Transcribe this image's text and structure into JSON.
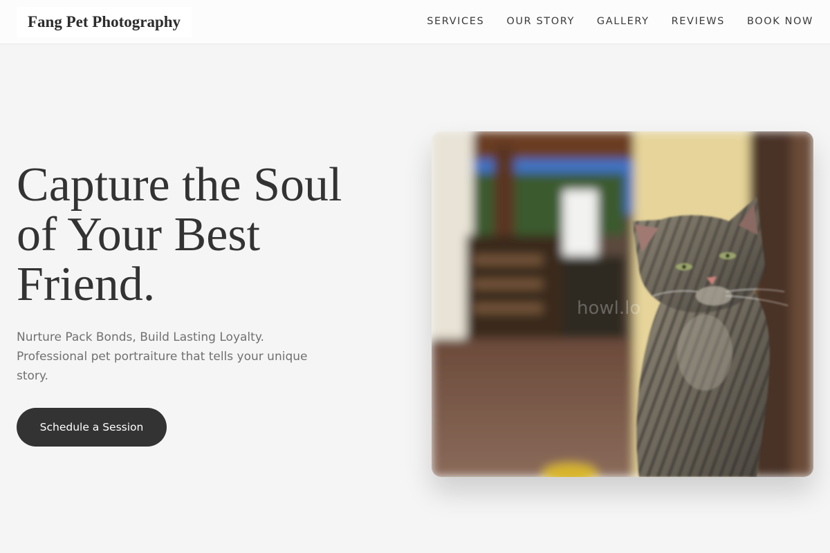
{
  "brand": {
    "name": "Fang Pet Photography"
  },
  "nav": {
    "items": [
      {
        "label": "SERVICES"
      },
      {
        "label": "OUR STORY"
      },
      {
        "label": "GALLERY"
      },
      {
        "label": "REVIEWS"
      },
      {
        "label": "BOOK NOW"
      }
    ]
  },
  "hero": {
    "title": "Capture the Soul of Your Best Friend.",
    "subtitle_line1": "Nurture Pack Bonds, Build Lasting Loyalty.",
    "subtitle_line2": "Professional pet portraiture that tells your unique story.",
    "cta_label": "Schedule a Session",
    "image_watermark": "howl.lo"
  },
  "colors": {
    "background": "#f5f5f5",
    "header_bg": "#fcfcfc",
    "text_dark": "#333333",
    "text_muted": "#707070",
    "button_bg": "#333333",
    "button_text": "#ffffff"
  }
}
